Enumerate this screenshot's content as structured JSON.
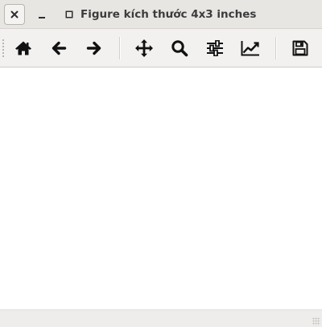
{
  "window": {
    "title": "Figure kích thước 4x3 inches",
    "controls": {
      "close_icon": "close-icon",
      "minimize_icon": "minimize-icon",
      "maximize_icon": "maximize-icon"
    }
  },
  "toolbar": {
    "buttons": [
      {
        "name": "home",
        "icon": "home-icon"
      },
      {
        "name": "back",
        "icon": "arrow-left-icon"
      },
      {
        "name": "forward",
        "icon": "arrow-right-icon"
      },
      {
        "name": "pan",
        "icon": "move-icon"
      },
      {
        "name": "zoom",
        "icon": "magnifier-icon"
      },
      {
        "name": "configure-subplots",
        "icon": "sliders-icon"
      },
      {
        "name": "edit-axis",
        "icon": "line-chart-icon"
      },
      {
        "name": "save",
        "icon": "floppy-disk-icon"
      }
    ]
  },
  "statusbar": {
    "message": ""
  }
}
